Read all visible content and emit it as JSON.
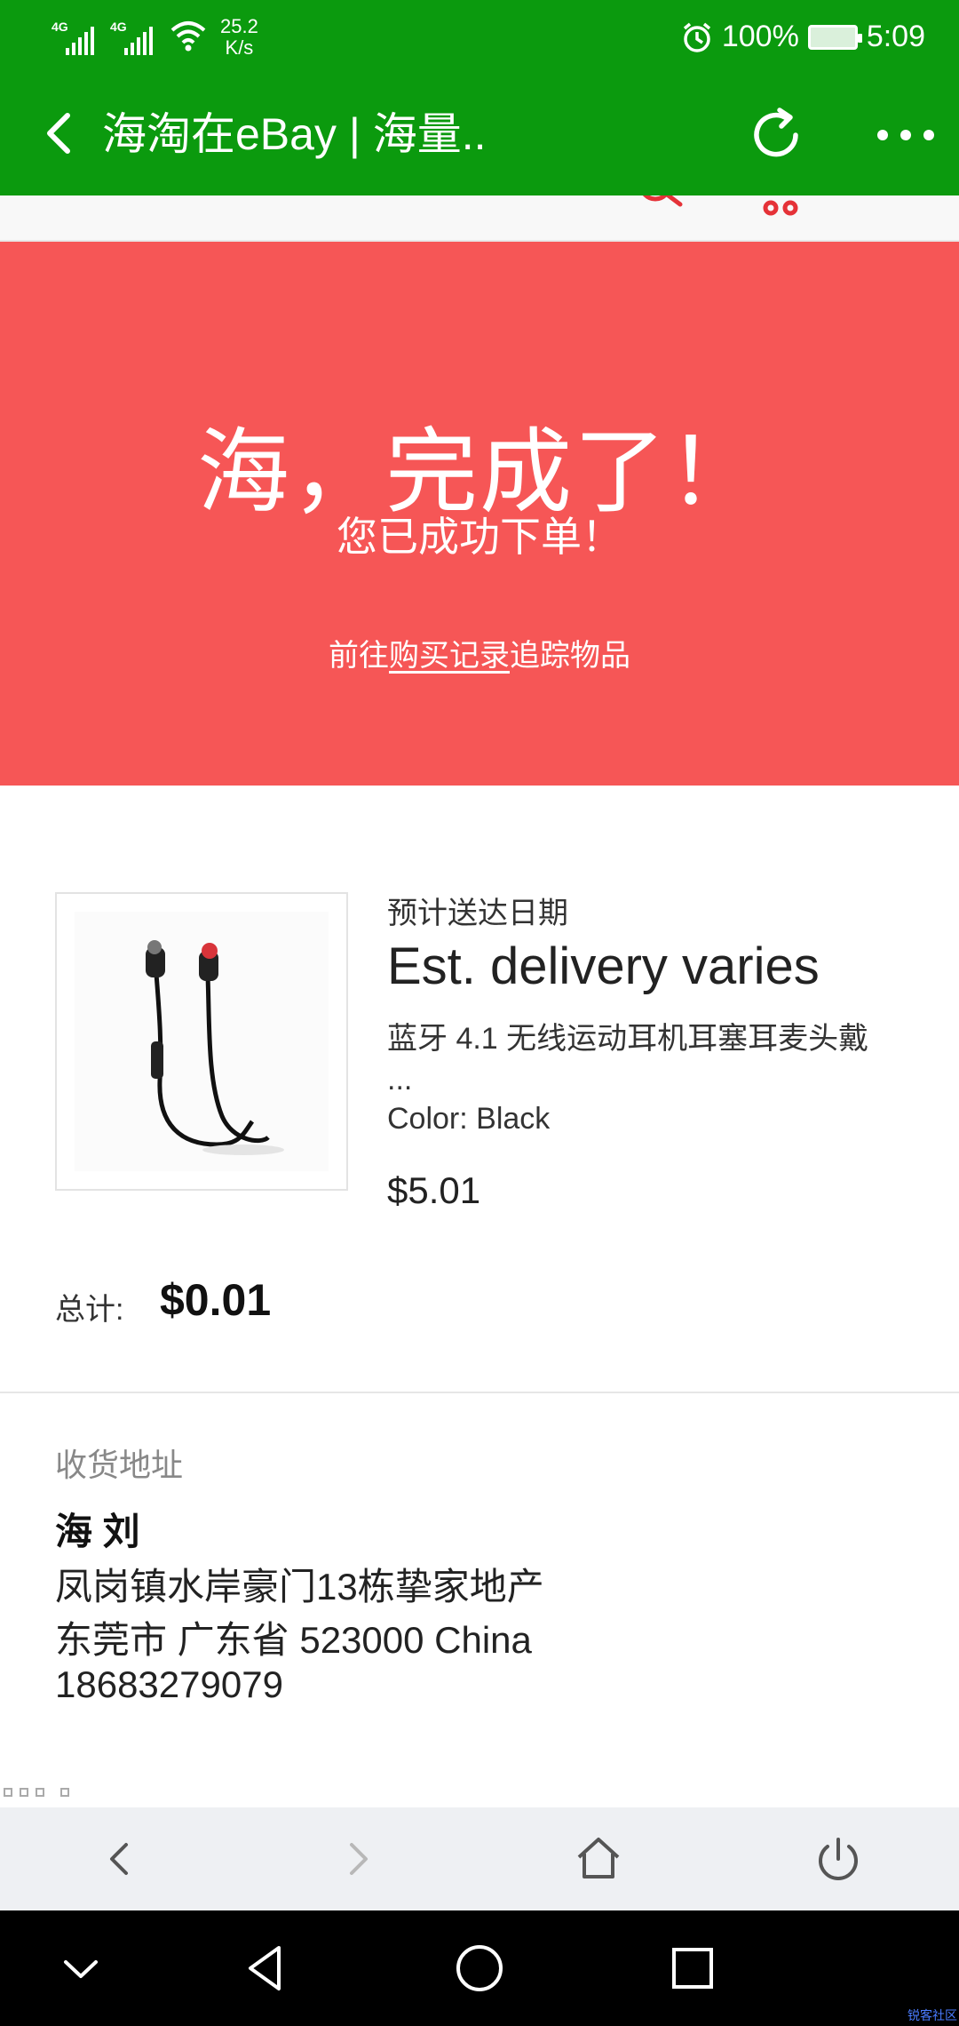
{
  "status_bar": {
    "signal1_label": "4G",
    "signal2_label": "4G",
    "net_speed_value": "25.2",
    "net_speed_unit": "K/s",
    "battery_text": "100%",
    "time": "5:09"
  },
  "titlebar": {
    "title": "海淘在eBay | 海量.."
  },
  "banner": {
    "headline": "海，完成了！",
    "subheadline": "您已成功下单！",
    "link_prefix": "前往",
    "link_text": "购买记录",
    "link_suffix": "追踪物品",
    "bg_color": "#f65656"
  },
  "item": {
    "est_label": "预计送达日期",
    "est_value": "Est. delivery varies",
    "title": "蓝牙 4.1 无线运动耳机耳塞耳麦头戴",
    "title_ellipsis": "...",
    "color": "Color: Black",
    "price": "$5.01"
  },
  "total": {
    "label": "总计:",
    "value": "$0.01"
  },
  "address": {
    "label": "收货地址",
    "name": "海 刘",
    "line1": "凤岗镇水岸豪门13栋挚家地产",
    "line2": "东莞市 广东省 523000 China",
    "phone": "18683279079"
  },
  "browser_nav": {
    "buttons": [
      "back-icon",
      "forward-icon",
      "home-icon",
      "power-icon"
    ]
  },
  "android_nav": {
    "buttons": [
      "chevron-down-icon",
      "back-triangle-icon",
      "home-circle-icon",
      "recents-square-icon"
    ]
  },
  "watermark": "锐客社区",
  "colors": {
    "wechat_green": "#0b9a0e",
    "banner_red": "#f65656"
  }
}
